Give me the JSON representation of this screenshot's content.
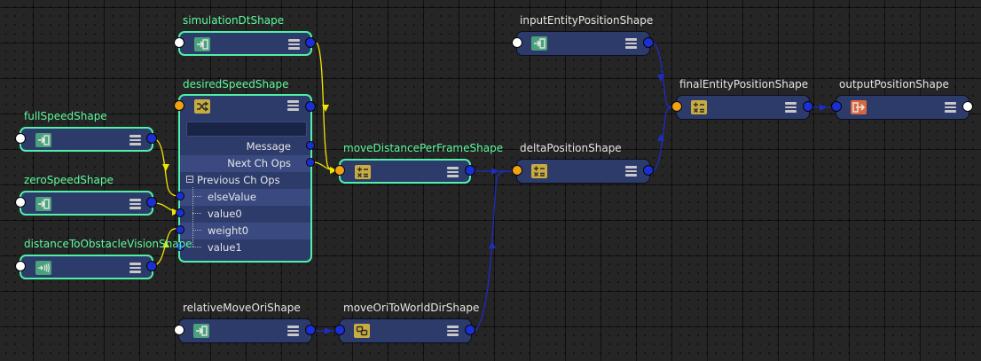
{
  "nodes": {
    "simulationDt": {
      "title": "simulationDtShape",
      "icon": "input-arrow-icon"
    },
    "desiredSpeed": {
      "title": "desiredSpeedShape",
      "icon": "shuffle-icon",
      "attributes": {
        "message": "Message",
        "next_ch_ops": "Next Ch Ops",
        "previous_ch_ops": "Previous Ch Ops",
        "else_value": "elseValue",
        "value0": "value0",
        "weight0": "weight0",
        "value1": "value1"
      }
    },
    "fullSpeed": {
      "title": "fullSpeedShape",
      "icon": "input-arrow-icon"
    },
    "zeroSpeed": {
      "title": "zeroSpeedShape",
      "icon": "input-arrow-icon"
    },
    "distanceToObstacle": {
      "title": "distanceToObstacleVisionShape",
      "icon": "sensor-waves-icon"
    },
    "moveDistancePerFrame": {
      "title": "moveDistancePerFrameShape",
      "icon": "math-operator-icon"
    },
    "inputEntityPosition": {
      "title": "inputEntityPositionShape",
      "icon": "input-arrow-icon"
    },
    "deltaPosition": {
      "title": "deltaPositionShape",
      "icon": "math-operator-icon"
    },
    "finalEntityPosition": {
      "title": "finalEntityPositionShape",
      "icon": "math-operator-icon"
    },
    "outputPosition": {
      "title": "outputPositionShape",
      "icon": "output-arrow-icon"
    },
    "relativeMoveOri": {
      "title": "relativeMoveOriShape",
      "icon": "input-arrow-icon"
    },
    "moveOriToWorldDir": {
      "title": "moveOriToWorldDirShape",
      "icon": "vector-transform-icon"
    }
  },
  "colors": {
    "background": "#252525",
    "node_body": "#2d3b6b",
    "selection_outline": "#4ff0a8",
    "selected_title": "#5dfa9d",
    "port_blue": "#1c2fd4",
    "port_orange": "#f3a114",
    "wire_yellow": "#f2e600",
    "wire_blue": "#1e2cc4"
  }
}
